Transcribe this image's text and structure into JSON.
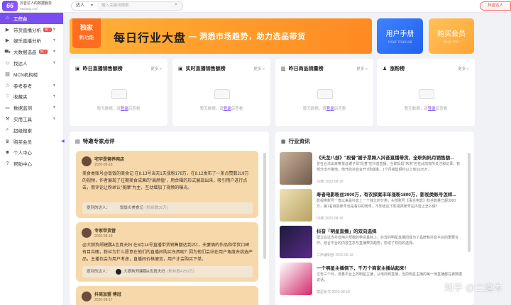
{
  "topbar": {
    "logo_mark": "66",
    "logo_title": "抖音达人的数据服务",
    "logo_sub": "66dianp.com",
    "search_type": "达人",
    "search_placeholder": "输入关键词搜索",
    "right_pill": "抖音达人"
  },
  "sidebar": {
    "items": [
      {
        "label": "工作台",
        "icon": "home-icon",
        "active": true
      },
      {
        "label": "带货直播分析",
        "icon": "live-icon",
        "badge": "热门",
        "chevron": true
      },
      {
        "label": "娱乐直播分析",
        "icon": "live-icon",
        "chevron": true
      },
      {
        "label": "大数据选品",
        "icon": "cart-icon",
        "badge": "热门",
        "chevron": true
      },
      {
        "label": "找达人",
        "icon": "user-icon",
        "chevron": true
      },
      {
        "label": "MCN机构榜",
        "icon": "rank-icon"
      },
      {
        "label": "参考参考",
        "icon": "star-icon",
        "chevron": true
      },
      {
        "label": "收藏夹",
        "icon": "heart-icon",
        "chevron": true
      },
      {
        "label": "数据监测",
        "icon": "monitor-icon",
        "chevron": true
      },
      {
        "label": "实用工具",
        "icon": "tool-icon",
        "chevron": true
      },
      {
        "label": "超级搜索",
        "icon": "search-icon"
      },
      {
        "label": "购买会员",
        "icon": "vip-icon"
      },
      {
        "label": "个人中心",
        "icon": "person-icon"
      },
      {
        "label": "帮助中心",
        "icon": "help-icon"
      }
    ]
  },
  "banner": {
    "tag_line1": "独家",
    "tag_line2": "新功能",
    "title": "每日行业大盘",
    "subtitle": "— 洞悉市场趋势，助力选品带货"
  },
  "promos": {
    "manual_title": "用户手册",
    "manual_sub": "User manual",
    "vip_title": "购买会员",
    "vip_sub": "Buy VIP"
  },
  "rank_cards": [
    {
      "title": "昨日直播销售额榜",
      "more": "更多 >"
    },
    {
      "title": "实时直播销售额榜",
      "more": "更多 >"
    },
    {
      "title": "昨日商品销量榜",
      "more": "更多 >"
    },
    {
      "title": "涨粉榜",
      "more": "更多 >"
    }
  ],
  "empty": {
    "prefix": "暂无数据，请",
    "link": "登录",
    "suffix": "后查看"
  },
  "expert": {
    "title": "特邀专家点评",
    "cards": [
      {
        "name": "宅宇是营养网店",
        "date": "2020-08-18",
        "body": "美食类账号@饭饭的美食记 在8.13号当天1天涨粉178万，在8.12发布了一条点赞数219万的视频，作者展现了往期美食成果的\"高颜值\"，用合辑的形式展现出来，吸引用户进行点击，而评论让粉丝认\"美摩\"为主，互动增加了视频的曝光。",
        "mention_label": "提到的达人：",
        "mention_name": "饭饭の美食记",
        "mention_fans": "(粉丝数30万)"
      },
      {
        "name": "专家带货营",
        "date": "2020-08-18",
        "body": "@大狼狗郑建鹏&言真夫妇 在8月14号直播带货销售额达到2亿，夫妻俩的作品和带货口碑有目共睹，粉丝为什么愿意在他们的直播间购买东西呢？因为他们会站在用户角度去挑选产品，主播也会为用户考虑，直播间价格便宜，用户才会购买下单。",
        "mention_label": "提到的达人：",
        "mention_name": "大狼狗郑建鹏&言真夫妇",
        "mention_fans": "(粉丝数4255万)"
      },
      {
        "name": "抖商加盟 博冠",
        "date": "2020-08-17"
      }
    ]
  },
  "news": {
    "title": "行业资讯",
    "items": [
      {
        "title": "《天龙八部》\"段誉\"谢子昂跨入抖音直播带货，全职妈妈月销售额...",
        "desc": "曾在合法出来带货@谢子昂\"段誉\"在抖音直播，全职妈妈\"朱朱\"也在此前有所关注和记录。有部分出不抱他、他开的抖音会开7场直播，1个月销售额约以上到1625万。",
        "meta": "66榜  2020-08-18"
      },
      {
        "title": "寿者电影粉丝3900万，有衣探案丰年涨粉1800万，影视类账号怎样...",
        "desc": "影视类账号一直以来是抖音上一个独立的分类，头部账号【毒舌电影】粉丝数量已超3900万，第1名目前账号也是看好的榜单，不知道这下影视类账号在抖音上怎么做？",
        "meta": "66榜  2020-08-18"
      },
      {
        "title": "抖音「明星直播」的双向选择",
        "desc": "建立在过去抖音用户规模的带货基础上，抖音的明星直播间成为了品牌和抖音平台的重要合作。结合平台的内容生态与直播带货趋势，形成了双向的选择。",
        "meta": "三声编辑部  2020-08-18"
      },
      {
        "title": "一个明星主播倒下，千万个商家主播站起来！",
        "desc": "过去三个月，流量平台上的明星主播，从电商到直播，当前明星主播的每一场直播都在被数据说话。",
        "meta": "模型秘书  2020-08-18"
      }
    ]
  },
  "watermark": "知乎 @二道木",
  "colors": {
    "accent": "#7a4df0",
    "banner_orange": "#ff9f2c",
    "expert_card": "#f7d8ab",
    "manual_blue": "#2f6ff5",
    "vip_gold": "#ffb040"
  }
}
